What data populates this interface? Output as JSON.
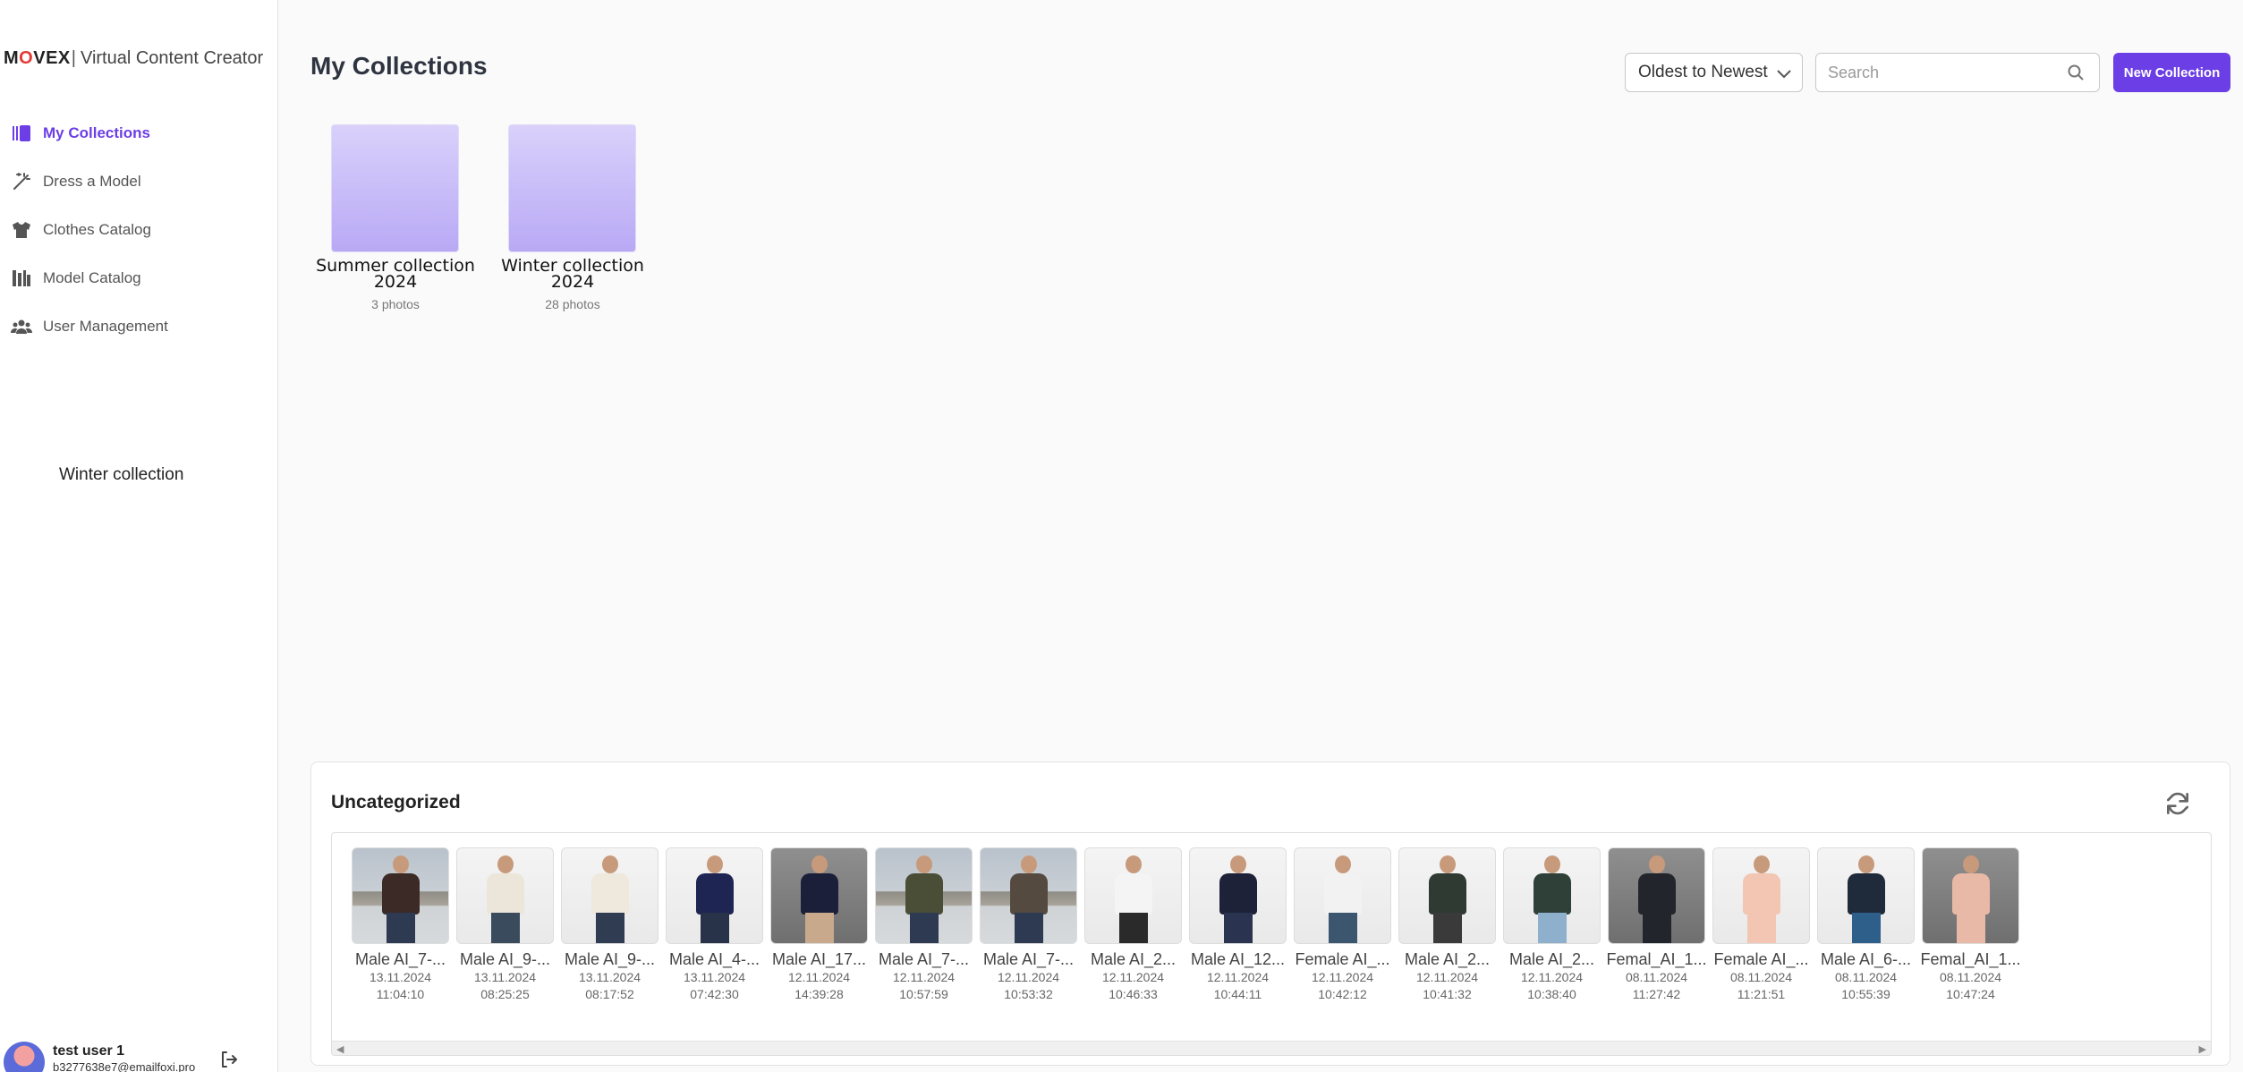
{
  "brand": {
    "logo": "MOVEX",
    "separator": "|",
    "name": "Virtual Content Creator"
  },
  "nav": [
    {
      "label": "My Collections",
      "icon": "collections-icon",
      "active": true
    },
    {
      "label": "Dress a Model",
      "icon": "magic-wand-icon",
      "active": false
    },
    {
      "label": "Clothes Catalog",
      "icon": "shirt-icon",
      "active": false
    },
    {
      "label": "Model Catalog",
      "icon": "catalog-icon",
      "active": false
    },
    {
      "label": "User Management",
      "icon": "users-icon",
      "active": false
    }
  ],
  "sidebar_note": "Winter collection",
  "user": {
    "name": "test user 1",
    "email": "b3277638e7@emailfoxi.pro"
  },
  "header": {
    "title": "My Collections",
    "sort_value": "Oldest to Newest",
    "search_placeholder": "Search",
    "new_button": "New Collection"
  },
  "collections": [
    {
      "name": "Summer collection 2024",
      "count": "3 photos"
    },
    {
      "name": "Winter collection 2024",
      "count": "28 photos"
    }
  ],
  "uncategorized": {
    "title": "Uncategorized",
    "items": [
      {
        "name": "Male AI_7-...",
        "date": "13.11.2024",
        "time": "11:04:10",
        "bg": "city",
        "top": "#3b2a26",
        "bottom": "#2d3a52"
      },
      {
        "name": "Male AI_9-...",
        "date": "13.11.2024",
        "time": "08:25:25",
        "bg": "light",
        "top": "#ece6da",
        "bottom": "#3b4b5e"
      },
      {
        "name": "Male AI_9-...",
        "date": "13.11.2024",
        "time": "08:17:52",
        "bg": "light",
        "top": "#efe8dc",
        "bottom": "#2f3c52"
      },
      {
        "name": "Male AI_4-...",
        "date": "13.11.2024",
        "time": "07:42:30",
        "bg": "light",
        "top": "#1f2552",
        "bottom": "#283248"
      },
      {
        "name": "Male AI_17...",
        "date": "12.11.2024",
        "time": "14:39:28",
        "bg": "gray",
        "top": "#1c1f3a",
        "bottom": "#c9a98c"
      },
      {
        "name": "Male AI_7-...",
        "date": "12.11.2024",
        "time": "10:57:59",
        "bg": "city",
        "top": "#4a4e36",
        "bottom": "#2d3a52"
      },
      {
        "name": "Male AI_7-...",
        "date": "12.11.2024",
        "time": "10:53:32",
        "bg": "city",
        "top": "#544a40",
        "bottom": "#2d3a52"
      },
      {
        "name": "Male AI_2...",
        "date": "12.11.2024",
        "time": "10:46:33",
        "bg": "light",
        "top": "#f4f4f4",
        "bottom": "#2a2a2a"
      },
      {
        "name": "Male AI_12...",
        "date": "12.11.2024",
        "time": "10:44:11",
        "bg": "light",
        "top": "#1d2238",
        "bottom": "#2a3350"
      },
      {
        "name": "Female AI_...",
        "date": "12.11.2024",
        "time": "10:42:12",
        "bg": "light",
        "top": "#f2f2f2",
        "bottom": "#3c5670"
      },
      {
        "name": "Male AI_2...",
        "date": "12.11.2024",
        "time": "10:41:32",
        "bg": "light",
        "top": "#2e3a32",
        "bottom": "#3a3a3a"
      },
      {
        "name": "Male AI_2...",
        "date": "12.11.2024",
        "time": "10:38:40",
        "bg": "light",
        "top": "#2f4038",
        "bottom": "#8fb0cc"
      },
      {
        "name": "Femal_AI_1...",
        "date": "08.11.2024",
        "time": "11:27:42",
        "bg": "gray",
        "top": "#22262c",
        "bottom": "#22262c"
      },
      {
        "name": "Female AI_...",
        "date": "08.11.2024",
        "time": "11:21:51",
        "bg": "light",
        "top": "#f2c6b2",
        "bottom": "#f2c6b2"
      },
      {
        "name": "Male AI_6-...",
        "date": "08.11.2024",
        "time": "10:55:39",
        "bg": "light",
        "top": "#1f2a3a",
        "bottom": "#2e5f8a"
      },
      {
        "name": "Femal_AI_1...",
        "date": "08.11.2024",
        "time": "10:47:24",
        "bg": "gray",
        "top": "#e8b9a6",
        "bottom": "#e8b9a6"
      }
    ]
  },
  "colors": {
    "accent": "#6c3ee6",
    "collection_thumb": "#c9bcf8"
  }
}
